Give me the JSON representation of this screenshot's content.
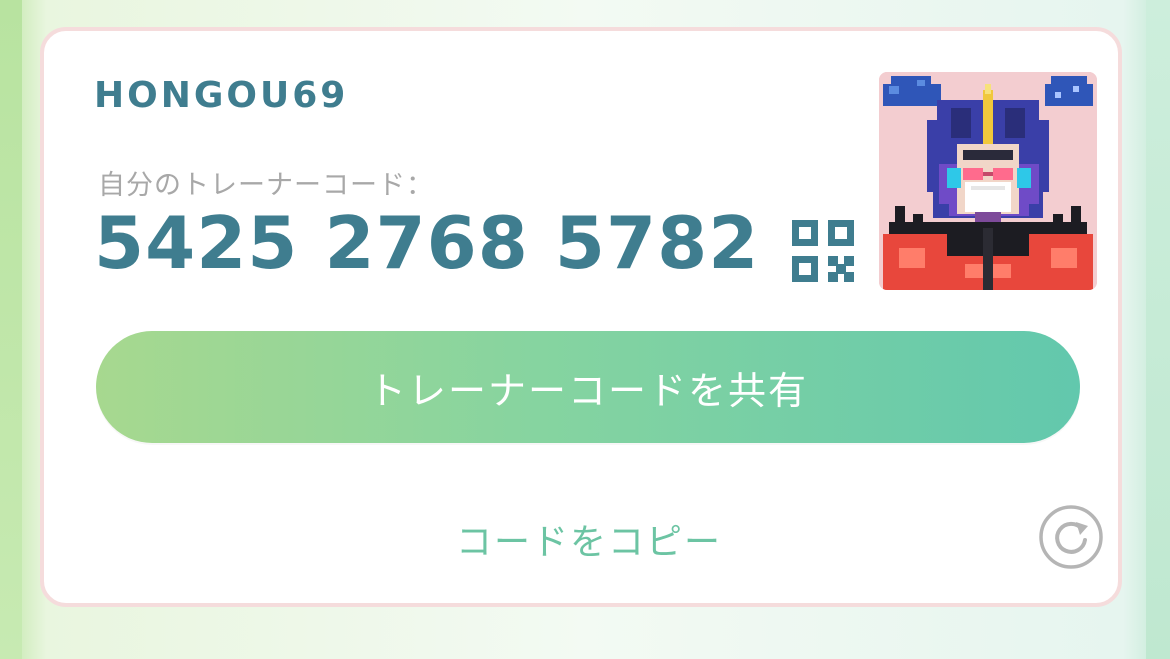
{
  "trainer": {
    "name": "HONGOU69",
    "code_label": "自分のトレーナーコード：",
    "code": "5425 2768 5782"
  },
  "actions": {
    "share_label": "トレーナーコードを共有",
    "copy_label": "コードをコピー"
  },
  "icons": {
    "qr": "qr-code-icon",
    "refresh": "refresh-icon",
    "avatar": "trainer-avatar"
  },
  "colors": {
    "primary_text": "#3f7d8f",
    "muted_text": "#a8a8a8",
    "accent_green": "#6cc4a3",
    "button_gradient_start": "#a7d88f",
    "button_gradient_end": "#62c8ad",
    "card_border": "#f5dcdc"
  }
}
